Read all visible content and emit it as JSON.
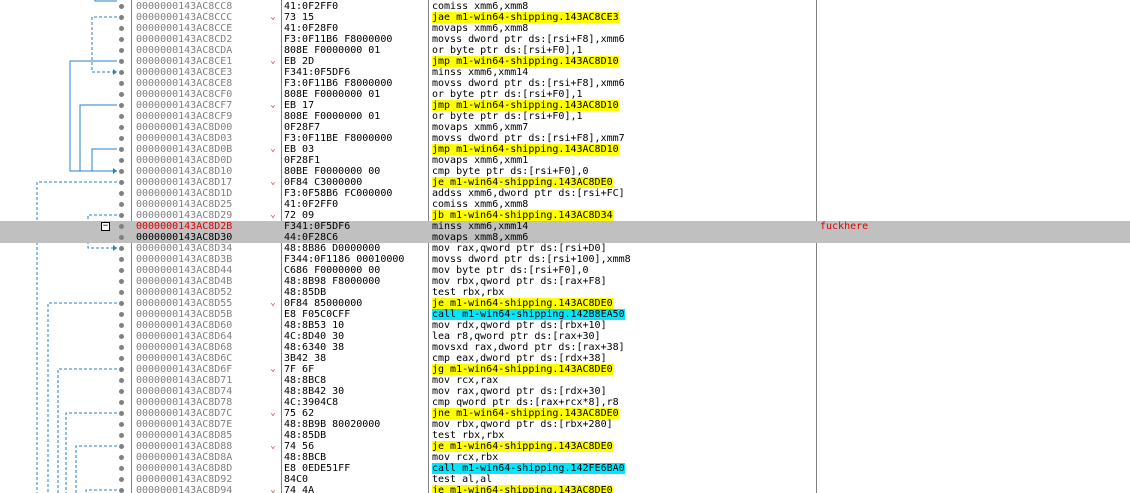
{
  "view": {
    "title": "",
    "comment_color": "#e00000",
    "jump_highlight": "#ffff00",
    "call_highlight": "#00e8ff"
  },
  "rows": [
    {
      "addr": "0000000143AC8CC8",
      "bytes": "41:0F2FF0",
      "mn": "comiss xmm6,xmm8",
      "hl": "",
      "arrow": ""
    },
    {
      "addr": "0000000143AC8CCC",
      "bytes": "73 15",
      "mn": "jae m1-win64-shipping.143AC8CE3",
      "hl": "jump",
      "arrow": "v"
    },
    {
      "addr": "0000000143AC8CCE",
      "bytes": "41:0F28F0",
      "mn": "movaps xmm6,xmm8",
      "hl": "",
      "arrow": ""
    },
    {
      "addr": "0000000143AC8CD2",
      "bytes": "F3:0F11B6 F8000000",
      "mn": "movss dword ptr ds:[rsi+F8],xmm6",
      "hl": "",
      "arrow": ""
    },
    {
      "addr": "0000000143AC8CDA",
      "bytes": "808E F0000000 01",
      "mn": "or byte ptr ds:[rsi+F0],1",
      "hl": "",
      "arrow": ""
    },
    {
      "addr": "0000000143AC8CE1",
      "bytes": "EB 2D",
      "mn": "jmp m1-win64-shipping.143AC8D10",
      "hl": "jump",
      "arrow": "v"
    },
    {
      "addr": "0000000143AC8CE3",
      "bytes": "F341:0F5DF6",
      "mn": "minss xmm6,xmm14",
      "hl": "",
      "arrow": ""
    },
    {
      "addr": "0000000143AC8CE8",
      "bytes": "F3:0F11B6 F8000000",
      "mn": "movss dword ptr ds:[rsi+F8],xmm6",
      "hl": "",
      "arrow": ""
    },
    {
      "addr": "0000000143AC8CF0",
      "bytes": "808E F0000000 01",
      "mn": "or byte ptr ds:[rsi+F0],1",
      "hl": "",
      "arrow": ""
    },
    {
      "addr": "0000000143AC8CF7",
      "bytes": "EB 17",
      "mn": "jmp m1-win64-shipping.143AC8D10",
      "hl": "jump",
      "arrow": "v"
    },
    {
      "addr": "0000000143AC8CF9",
      "bytes": "808E F0000000 01",
      "mn": "or byte ptr ds:[rsi+F0],1",
      "hl": "",
      "arrow": ""
    },
    {
      "addr": "0000000143AC8D00",
      "bytes": "0F28F7",
      "mn": "movaps xmm6,xmm7",
      "hl": "",
      "arrow": ""
    },
    {
      "addr": "0000000143AC8D03",
      "bytes": "F3:0F11BE F8000000",
      "mn": "movss dword ptr ds:[rsi+F8],xmm7",
      "hl": "",
      "arrow": ""
    },
    {
      "addr": "0000000143AC8D0B",
      "bytes": "EB 03",
      "mn": "jmp m1-win64-shipping.143AC8D10",
      "hl": "jump",
      "arrow": "v"
    },
    {
      "addr": "0000000143AC8D0D",
      "bytes": "0F28F1",
      "mn": "movaps xmm6,xmm1",
      "hl": "",
      "arrow": ""
    },
    {
      "addr": "0000000143AC8D10",
      "bytes": "80BE F0000000 00",
      "mn": "cmp byte ptr ds:[rsi+F0],0",
      "hl": "",
      "arrow": ""
    },
    {
      "addr": "0000000143AC8D17",
      "bytes": "0F84 C3000000",
      "mn": "je m1-win64-shipping.143AC8DE0",
      "hl": "jump",
      "arrow": "v"
    },
    {
      "addr": "0000000143AC8D1D",
      "bytes": "F3:0F58B6 FC000000",
      "mn": "addss xmm6,dword ptr ds:[rsi+FC]",
      "hl": "",
      "arrow": ""
    },
    {
      "addr": "0000000143AC8D25",
      "bytes": "41:0F2FF0",
      "mn": "comiss xmm6,xmm8",
      "hl": "",
      "arrow": ""
    },
    {
      "addr": "0000000143AC8D29",
      "bytes": "72 09",
      "mn": "jb m1-win64-shipping.143AC8D34",
      "hl": "jump",
      "arrow": "v"
    },
    {
      "addr": "0000000143AC8D2B",
      "bytes": "F341:0F5DF6",
      "mn": "minss xmm6,xmm14",
      "hl": "",
      "arrow": "",
      "sel": true,
      "hit": true,
      "comment": "fuckhere"
    },
    {
      "addr": "0000000143AC8D30",
      "bytes": "44:0F28C6",
      "mn": "movaps xmm8,xmm6",
      "hl": "",
      "arrow": "",
      "sel": true
    },
    {
      "addr": "0000000143AC8D34",
      "bytes": "48:8B86 D0000000",
      "mn": "mov rax,qword ptr ds:[rsi+D0]",
      "hl": "",
      "arrow": ""
    },
    {
      "addr": "0000000143AC8D3B",
      "bytes": "F344:0F1186 00010000",
      "mn": "movss dword ptr ds:[rsi+100],xmm8",
      "hl": "",
      "arrow": ""
    },
    {
      "addr": "0000000143AC8D44",
      "bytes": "C686 F0000000 00",
      "mn": "mov byte ptr ds:[rsi+F0],0",
      "hl": "",
      "arrow": ""
    },
    {
      "addr": "0000000143AC8D4B",
      "bytes": "48:8B98 F8000000",
      "mn": "mov rbx,qword ptr ds:[rax+F8]",
      "hl": "",
      "arrow": ""
    },
    {
      "addr": "0000000143AC8D52",
      "bytes": "48:85DB",
      "mn": "test rbx,rbx",
      "hl": "",
      "arrow": ""
    },
    {
      "addr": "0000000143AC8D55",
      "bytes": "0F84 85000000",
      "mn": "je m1-win64-shipping.143AC8DE0",
      "hl": "jump",
      "arrow": "v"
    },
    {
      "addr": "0000000143AC8D5B",
      "bytes": "E8 F05C0CFF",
      "mn": "call m1-win64-shipping.142B8EA50",
      "hl": "call",
      "arrow": ""
    },
    {
      "addr": "0000000143AC8D60",
      "bytes": "48:8B53 10",
      "mn": "mov rdx,qword ptr ds:[rbx+10]",
      "hl": "",
      "arrow": ""
    },
    {
      "addr": "0000000143AC8D64",
      "bytes": "4C:8D40 30",
      "mn": "lea r8,qword ptr ds:[rax+30]",
      "hl": "",
      "arrow": ""
    },
    {
      "addr": "0000000143AC8D68",
      "bytes": "48:6340 38",
      "mn": "movsxd rax,dword ptr ds:[rax+38]",
      "hl": "",
      "arrow": ""
    },
    {
      "addr": "0000000143AC8D6C",
      "bytes": "3B42 38",
      "mn": "cmp eax,dword ptr ds:[rdx+38]",
      "hl": "",
      "arrow": ""
    },
    {
      "addr": "0000000143AC8D6F",
      "bytes": "7F 6F",
      "mn": "jg m1-win64-shipping.143AC8DE0",
      "hl": "jump",
      "arrow": "v"
    },
    {
      "addr": "0000000143AC8D71",
      "bytes": "48:8BC8",
      "mn": "mov rcx,rax",
      "hl": "",
      "arrow": ""
    },
    {
      "addr": "0000000143AC8D74",
      "bytes": "48:8B42 30",
      "mn": "mov rax,qword ptr ds:[rdx+30]",
      "hl": "",
      "arrow": ""
    },
    {
      "addr": "0000000143AC8D78",
      "bytes": "4C:3904C8",
      "mn": "cmp qword ptr ds:[rax+rcx*8],r8",
      "hl": "",
      "arrow": ""
    },
    {
      "addr": "0000000143AC8D7C",
      "bytes": "75 62",
      "mn": "jne m1-win64-shipping.143AC8DE0",
      "hl": "jump",
      "arrow": "v"
    },
    {
      "addr": "0000000143AC8D7E",
      "bytes": "48:8B9B 80020000",
      "mn": "mov rbx,qword ptr ds:[rbx+280]",
      "hl": "",
      "arrow": ""
    },
    {
      "addr": "0000000143AC8D85",
      "bytes": "48:85DB",
      "mn": "test rbx,rbx",
      "hl": "",
      "arrow": ""
    },
    {
      "addr": "0000000143AC8D88",
      "bytes": "74 56",
      "mn": "je m1-win64-shipping.143AC8DE0",
      "hl": "jump",
      "arrow": "v"
    },
    {
      "addr": "0000000143AC8D8A",
      "bytes": "48:8BCB",
      "mn": "mov rcx,rbx",
      "hl": "",
      "arrow": ""
    },
    {
      "addr": "0000000143AC8D8D",
      "bytes": "E8 0EDE51FF",
      "mn": "call m1-win64-shipping.142FE6BA0",
      "hl": "call",
      "arrow": ""
    },
    {
      "addr": "0000000143AC8D92",
      "bytes": "84C0",
      "mn": "test al,al",
      "hl": "",
      "arrow": ""
    },
    {
      "addr": "0000000143AC8D94",
      "bytes": "74 4A",
      "mn": "je m1-win64-shipping.143AC8DE0",
      "hl": "jump",
      "arrow": "v"
    }
  ]
}
